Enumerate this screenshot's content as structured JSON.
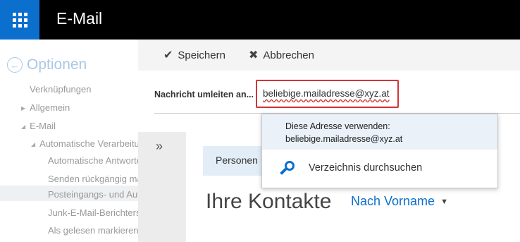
{
  "app": {
    "title": "E-Mail"
  },
  "options": {
    "title": "Optionen",
    "items": [
      {
        "label": "Verknüpfungen"
      },
      {
        "label": "Allgemein"
      },
      {
        "label": "E-Mail"
      },
      {
        "label": "Automatische Verarbeitung"
      },
      {
        "label": "Automatische Antworten"
      },
      {
        "label": "Senden rückgängig machen"
      },
      {
        "label": "Posteingangs- und Aufräumregeln"
      },
      {
        "label": "Junk-E-Mail-Berichterstattung"
      },
      {
        "label": "Als gelesen markieren"
      }
    ]
  },
  "toolbar": {
    "save_label": "Speichern",
    "cancel_label": "Abbrechen"
  },
  "forward": {
    "label": "Nachricht umleiten an...",
    "value": "beliebige.mailadresse@xyz.at"
  },
  "suggestions": {
    "use_address_label": "Diese Adresse verwenden:",
    "use_address_value": "beliebige.mailadresse@xyz.at",
    "search_label": "Verzeichnis durchsuchen"
  },
  "picker": {
    "expand_glyph": "»",
    "tab_label": "Personen",
    "contacts_title": "Ihre Kontakte",
    "sort_label": "Nach Vorname"
  },
  "colors": {
    "accent": "#0b6fce",
    "error": "#d13438",
    "topbar": "#000000"
  },
  "icons": [
    "app-launcher-icon",
    "back-arrow-icon",
    "checkmark-icon",
    "close-icon",
    "search-icon",
    "chevron-down-icon",
    "expand-icon"
  ]
}
